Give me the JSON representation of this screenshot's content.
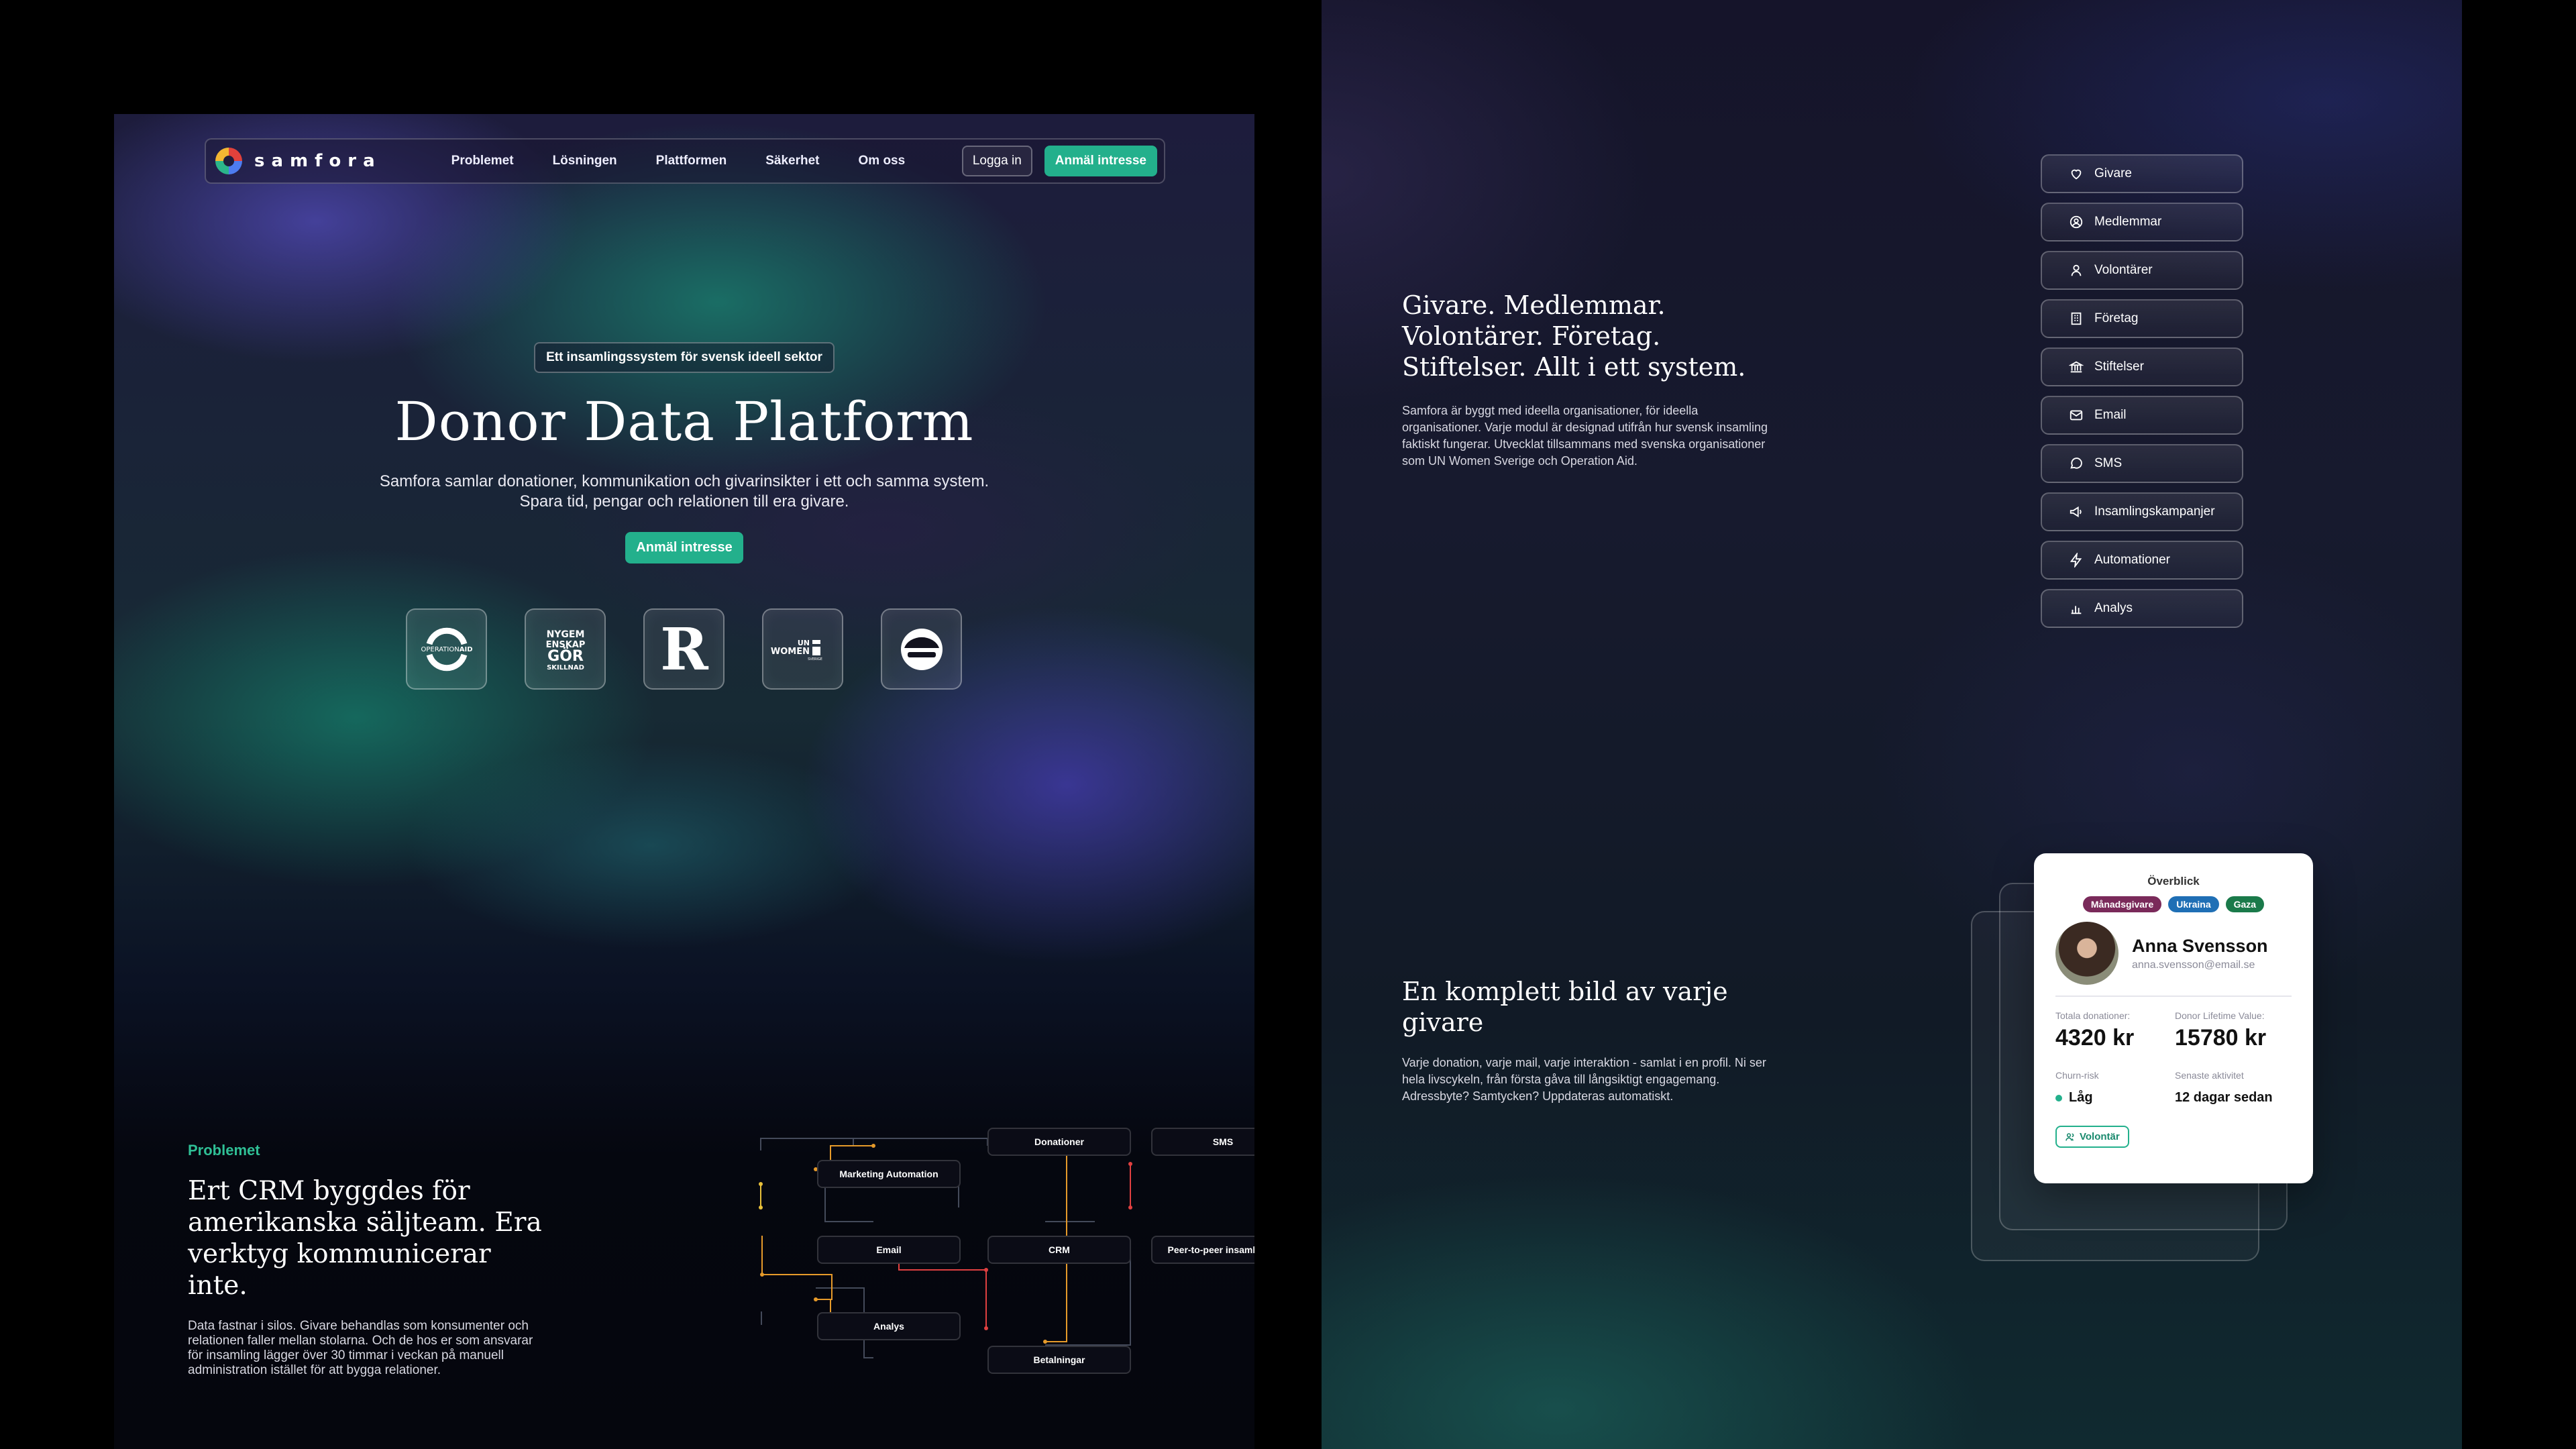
{
  "nav": {
    "logo_text": "samfora",
    "links": [
      "Problemet",
      "Lösningen",
      "Plattformen",
      "Säkerhet",
      "Om oss"
    ],
    "login": "Logga in",
    "cta": "Anmäl intresse"
  },
  "hero": {
    "badge": "Ett insamlingssystem för svensk ideell sektor",
    "title": "Donor Data Platform",
    "subtitle_line1": "Samfora samlar donationer, kommunikation och givarinsikter i ett och samma system.",
    "subtitle_line2": "Spara tid, pengar och relationen till era givare.",
    "cta": "Anmäl intresse"
  },
  "partners": {
    "operation_aid_a": "OPERATION",
    "operation_aid_b": "AID",
    "nygemenskap_1": "NYGEM",
    "nygemenskap_2": "ENSKAP",
    "nygemenskap_3": "GÖR",
    "nygemenskap_4": "SKILLNAD",
    "r_letter": "R",
    "unwomen_1": "UN",
    "unwomen_2": "WOMEN",
    "unwomen_3": "SVERIGE"
  },
  "problem": {
    "label": "Problemet",
    "title": "Ert CRM byggdes för amerikanska säljteam. Era verktyg kommunicerar inte.",
    "body": "Data fastnar i silos. Givare behandlas som konsumenter och relationen faller mellan stolarna. Och de hos er som ansvarar för insamling lägger över 30 timmar i veckan på manuell administration istället för att bygga relationer."
  },
  "flow": {
    "nodes": [
      "Donationer",
      "SMS",
      "Marketing Automation",
      "Email",
      "CRM",
      "Peer-to-peer insamlingar",
      "Analys",
      "Betalningar"
    ],
    "line_color": "#444a5a",
    "accent_orange": "#e69a2a",
    "accent_red": "#e04040",
    "accent_yellow": "#e8c03a"
  },
  "right": {
    "heading": "Givare. Medlemmar. Volontärer. Företag. Stiftelser. Allt i ett system.",
    "body": "Samfora är byggt med ideella organisationer, för ideella organisationer. Varje modul är designad utifrån hur svensk insamling faktiskt fungerar. Utvecklat tillsammans med svenska organisationer som UN Women Sverige och Operation Aid.",
    "heading2": "En komplett bild av varje givare",
    "body2": "Varje donation, varje mail, varje interaktion - samlat i en profil. Ni ser hela livscykeln, från första gåva till långsiktigt engagemang. Adressbyte? Samtycken? Uppdateras automatiskt."
  },
  "modules": [
    {
      "label": "Givare",
      "icon": "heart-icon"
    },
    {
      "label": "Medlemmar",
      "icon": "user-circle-icon"
    },
    {
      "label": "Volontärer",
      "icon": "user-icon"
    },
    {
      "label": "Företag",
      "icon": "building-icon"
    },
    {
      "label": "Stiftelser",
      "icon": "bank-icon"
    },
    {
      "label": "Email",
      "icon": "mail-icon"
    },
    {
      "label": "SMS",
      "icon": "chat-icon"
    },
    {
      "label": "Insamlingskampanjer",
      "icon": "megaphone-icon"
    },
    {
      "label": "Automationer",
      "icon": "lightning-icon"
    },
    {
      "label": "Analys",
      "icon": "bar-chart-icon"
    }
  ],
  "profile": {
    "title": "Överblick",
    "tags": [
      {
        "label": "Månadsgivare",
        "color": "#7a2a5a"
      },
      {
        "label": "Ukraina",
        "color": "#1f6fb5"
      },
      {
        "label": "Gaza",
        "color": "#1a7a4a"
      }
    ],
    "name": "Anna Svensson",
    "email": "anna.svensson@email.se",
    "total_label": "Totala donationer:",
    "total_value": "4320 kr",
    "ltv_label": "Donor Lifetime Value:",
    "ltv_value": "15780 kr",
    "churn_label": "Churn-risk",
    "churn_value": "Låg",
    "activity_label": "Senaste aktivitet",
    "activity_value": "12 dagar sedan",
    "role": "Volontär"
  },
  "colors": {
    "accent": "#23b08c",
    "background": "#000000"
  }
}
